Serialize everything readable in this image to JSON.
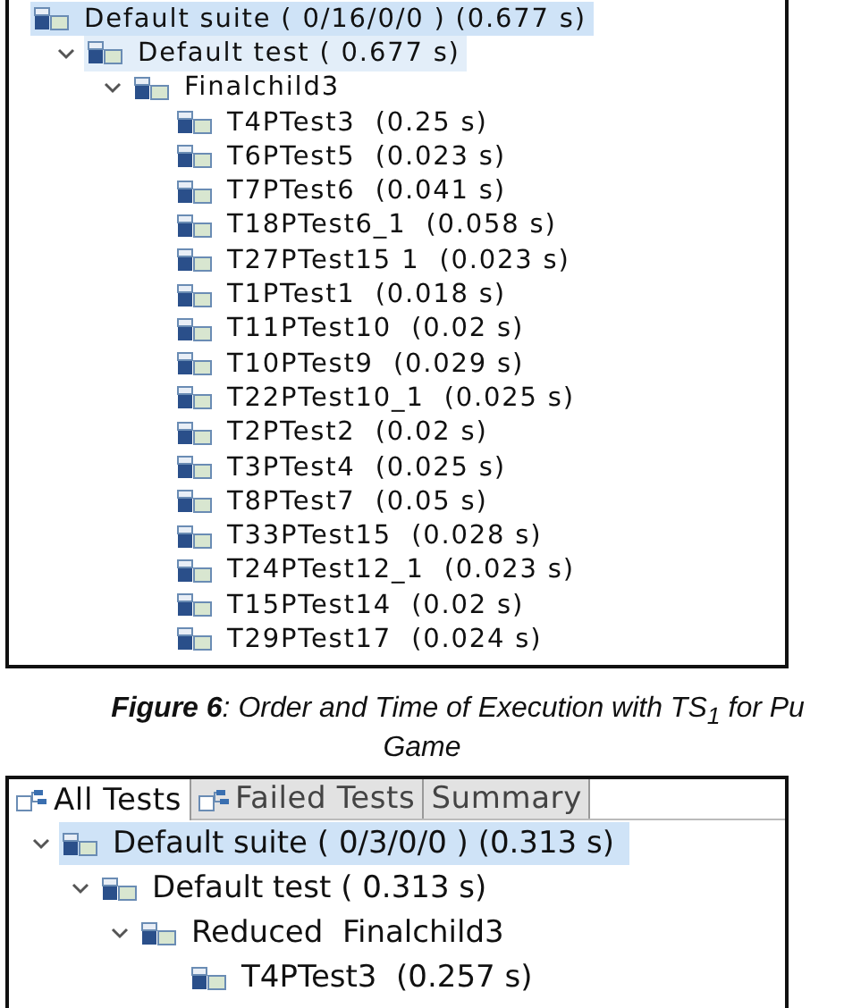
{
  "tree_panel_1": {
    "items": [
      {
        "label": "Default suite ( 0/16/0/0 ) (0.677 s)",
        "selected": true,
        "children": [
          {
            "label": "Default test ( 0.677 s)",
            "selected": true,
            "expanded": true,
            "children": [
              {
                "label": "Finalchild3",
                "selected": false,
                "expanded": true,
                "children": [
                  {
                    "label": "T4PTest3  (0.25 s)",
                    "selected": false
                  },
                  {
                    "label": "T6PTest5  (0.023 s)",
                    "selected": false
                  },
                  {
                    "label": "T7PTest6  (0.041 s)",
                    "selected": false
                  },
                  {
                    "label": "T18PTest6_1  (0.058 s)",
                    "selected": false
                  },
                  {
                    "label": "T27PTest15 1  (0.023 s)",
                    "selected": false
                  },
                  {
                    "label": "T1PTest1  (0.018 s)",
                    "selected": false
                  },
                  {
                    "label": "T11PTest10  (0.02 s)",
                    "selected": false
                  },
                  {
                    "label": "T10PTest9  (0.029 s)",
                    "selected": false
                  },
                  {
                    "label": "T22PTest10_1  (0.025 s)",
                    "selected": false
                  },
                  {
                    "label": "T2PTest2  (0.02 s)",
                    "selected": false
                  },
                  {
                    "label": "T3PTest4  (0.025 s)",
                    "selected": false
                  },
                  {
                    "label": "T8PTest7  (0.05 s)",
                    "selected": false
                  },
                  {
                    "label": "T33PTest15  (0.028 s)",
                    "selected": false
                  },
                  {
                    "label": "T24PTest12_1  (0.023 s)",
                    "selected": false
                  },
                  {
                    "label": "T15PTest14  (0.02 s)",
                    "selected": false
                  },
                  {
                    "label": "T29PTest17  (0.024 s)",
                    "selected": false
                  }
                ]
              }
            ]
          }
        ]
      }
    ]
  },
  "caption": {
    "line_1": "**Figure 6**: Order and Time of Execution with TS$_{1}$ for Pu",
    "line_2": "Game"
  },
  "tree_panel_2": {
    "tabs": [
      {
        "label": "All Tests",
        "selected": true,
        "kind": "tree"
      },
      {
        "label": "Failed Tests",
        "selected": false,
        "kind": "tree"
      },
      {
        "label": "Summary",
        "selected": false,
        "kind": "plain"
      }
    ],
    "items": [
      {
        "label": "Default suite ( 0/3/0/0 ) (0.313 s)",
        "selected": true,
        "expanded": true,
        "children": [
          {
            "label": "Default test ( 0.313 s)",
            "selected": false,
            "expanded": true,
            "children": [
              {
                "label": "Reduced  Finalchild3",
                "selected": false,
                "expanded": true,
                "children": [
                  {
                    "label": "T4PTest3  (0.257 s)",
                    "selected": false
                  }
                ]
              }
            ]
          }
        ]
      }
    ]
  }
}
